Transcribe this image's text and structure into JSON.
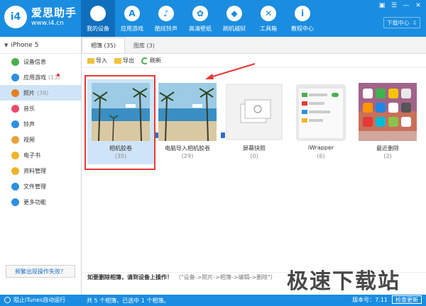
{
  "app": {
    "name": "爱思助手",
    "url": "www.i4.cn"
  },
  "nav": [
    {
      "label": "我的设备",
      "icon": "apple-icon",
      "glyph": ""
    },
    {
      "label": "应用游戏",
      "icon": "appstore-icon",
      "glyph": "A"
    },
    {
      "label": "酷炫铃声",
      "icon": "bell-icon",
      "glyph": "♪"
    },
    {
      "label": "高清壁纸",
      "icon": "flower-icon",
      "glyph": "✿"
    },
    {
      "label": "刷机越狱",
      "icon": "box-icon",
      "glyph": "◆"
    },
    {
      "label": "工具箱",
      "icon": "tools-icon",
      "glyph": "✕"
    },
    {
      "label": "教程中心",
      "icon": "info-icon",
      "glyph": "i"
    }
  ],
  "download_btn": "下载中心",
  "device": {
    "name": "iPhone 5"
  },
  "sidebar": {
    "items": [
      {
        "label": "设备信息",
        "count": "",
        "color": "#4caf50"
      },
      {
        "label": "应用游戏",
        "count": "(13)",
        "color": "#2f8fe0"
      },
      {
        "label": "照片",
        "count": "(38)",
        "color": "#e67e22"
      },
      {
        "label": "音乐",
        "count": "",
        "color": "#e84a6b"
      },
      {
        "label": "铃声",
        "count": "",
        "color": "#2f8fe0"
      },
      {
        "label": "视频",
        "count": "",
        "color": "#e6a23c"
      },
      {
        "label": "电子书",
        "count": "",
        "color": "#f0b429"
      },
      {
        "label": "资料管理",
        "count": "",
        "color": "#f0b429"
      },
      {
        "label": "文件管理",
        "count": "",
        "color": "#2f8fe0"
      },
      {
        "label": "更多功能",
        "count": "",
        "color": "#2f8fe0"
      }
    ],
    "help": "频繁出现操作失败？"
  },
  "tabs": [
    {
      "label": "相簿 (35)"
    },
    {
      "label": "图库 (3)"
    }
  ],
  "toolbar": {
    "import": "导入",
    "export": "导出",
    "refresh": "刷新"
  },
  "albums": [
    {
      "name": "相机胶卷",
      "count": "(35)"
    },
    {
      "name": "电脑导入相机胶卷",
      "count": "(29)"
    },
    {
      "name": "屏幕快照",
      "count": "(0)"
    },
    {
      "name": "iWrapper",
      "count": "(6)"
    },
    {
      "name": "最近删除",
      "count": "(2)"
    }
  ],
  "notice": {
    "bold": "如要删除相簿，请到设备上操作！",
    "sub": "（\"设备->照片->相簿->编辑->删除\"）"
  },
  "status": {
    "left": "阻止iTunes自动运行",
    "mid": "共 5 个相簿，已选中 1 个相簿。",
    "version": "版本号：7.11",
    "update": "检查更新"
  },
  "watermark": "极速下载站",
  "colors": {
    "primary": "#1a8de0",
    "highlight": "#e53935"
  }
}
